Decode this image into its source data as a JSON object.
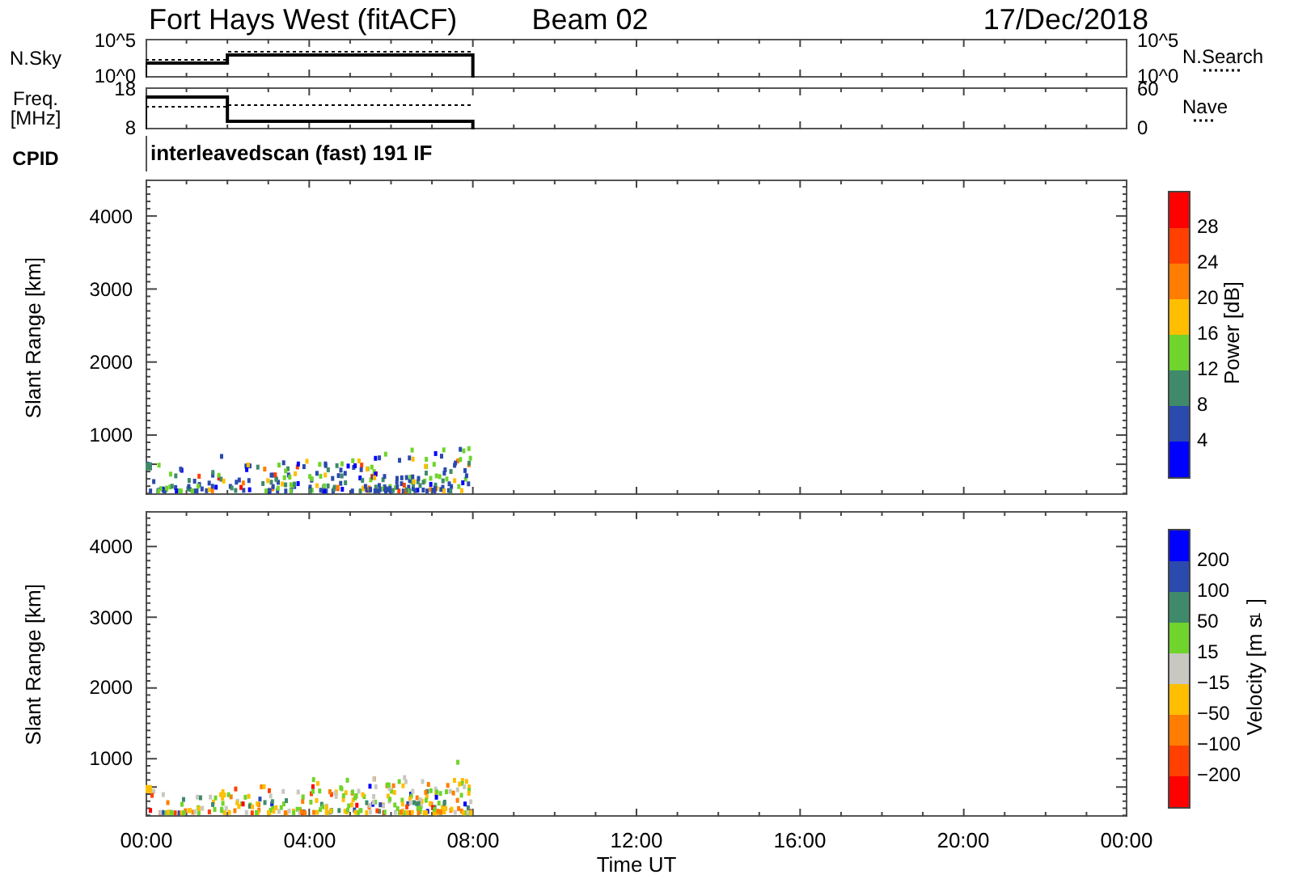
{
  "header": {
    "title": "Fort Hays West (fitACF)",
    "beam": "Beam 02",
    "date": "17/Dec/2018"
  },
  "noise_panel": {
    "label_lines": [
      "N.Sky"
    ],
    "left_ticks": [
      "10^5",
      "10^0"
    ],
    "right_ticks": [
      "10^5",
      "10^0"
    ],
    "right_label": "N.Search"
  },
  "freq_panel": {
    "label_lines": [
      "Freq.",
      "[MHz]"
    ],
    "left_ticks": [
      "18",
      "8"
    ],
    "right_ticks": [
      "60",
      "0"
    ],
    "right_label": "Nave"
  },
  "cpid": {
    "label": "CPID",
    "value": "interleavedscan (fast) 191 IF"
  },
  "power_panel": {
    "ylabel": "Slant Range [km]",
    "yticks": [
      "4000",
      "3000",
      "2000",
      "1000"
    ],
    "colorbar": {
      "title": "Power [dB]",
      "ticks": [
        "28",
        "24",
        "20",
        "16",
        "12",
        "8",
        "4"
      ],
      "segments": [
        {
          "color": "#ff0000"
        },
        {
          "color": "#ff4000"
        },
        {
          "color": "#ff7d00"
        },
        {
          "color": "#ffbe00"
        },
        {
          "color": "#6fd42b"
        },
        {
          "color": "#3f8a6a"
        },
        {
          "color": "#2a4aad"
        },
        {
          "color": "#0000ff"
        }
      ]
    }
  },
  "velocity_panel": {
    "ylabel": "Slant Range [km]",
    "yticks": [
      "4000",
      "3000",
      "2000",
      "1000"
    ],
    "colorbar": {
      "title": "Velocity [m s$^{-1}$]",
      "ticks": [
        "200",
        "100",
        "50",
        "15",
        "−15",
        "−50",
        "−100",
        "−200"
      ],
      "segments": [
        {
          "color": "#0000ff"
        },
        {
          "color": "#2a4aad"
        },
        {
          "color": "#3f8a6a"
        },
        {
          "color": "#6fd42b"
        },
        {
          "color": "#c8c8c0"
        },
        {
          "color": "#ffbe00"
        },
        {
          "color": "#ff7d00"
        },
        {
          "color": "#ff4000"
        },
        {
          "color": "#ff0000"
        }
      ]
    }
  },
  "xticks": [
    "00:00",
    "04:00",
    "08:00",
    "12:00",
    "16:00",
    "20:00",
    "00:00"
  ],
  "xlabel": "Time UT"
}
